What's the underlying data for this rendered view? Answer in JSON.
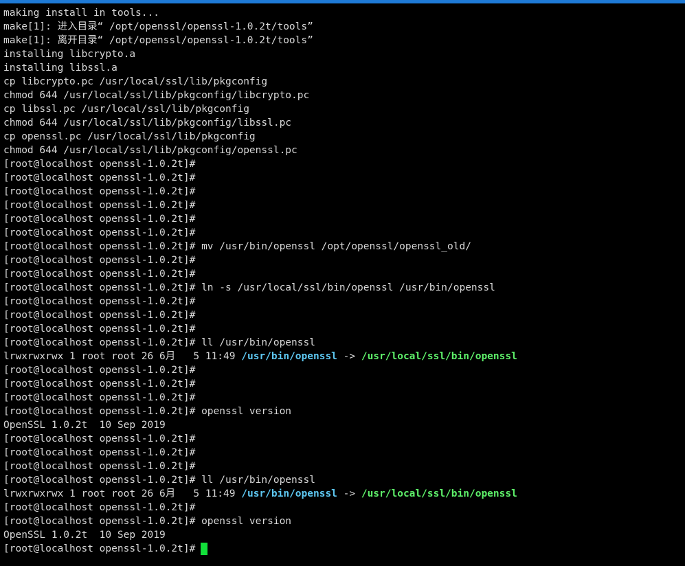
{
  "colors": {
    "background": "#000000",
    "text": "#d8d8d8",
    "symlink": "#5ec8f2",
    "symlink_target": "#5ef06a",
    "cursor": "#12e03a",
    "window_border": "#1e7ad6"
  },
  "terminal": {
    "lines": [
      [
        {
          "t": "making install in tools..."
        }
      ],
      [
        {
          "t": "make[1]: 进入目录“ /opt/openssl/openssl-1.0.2t/tools”"
        }
      ],
      [
        {
          "t": "make[1]: 离开目录“ /opt/openssl/openssl-1.0.2t/tools”"
        }
      ],
      [
        {
          "t": "installing libcrypto.a"
        }
      ],
      [
        {
          "t": "installing libssl.a"
        }
      ],
      [
        {
          "t": "cp libcrypto.pc /usr/local/ssl/lib/pkgconfig"
        }
      ],
      [
        {
          "t": "chmod 644 /usr/local/ssl/lib/pkgconfig/libcrypto.pc"
        }
      ],
      [
        {
          "t": "cp libssl.pc /usr/local/ssl/lib/pkgconfig"
        }
      ],
      [
        {
          "t": "chmod 644 /usr/local/ssl/lib/pkgconfig/libssl.pc"
        }
      ],
      [
        {
          "t": "cp openssl.pc /usr/local/ssl/lib/pkgconfig"
        }
      ],
      [
        {
          "t": "chmod 644 /usr/local/ssl/lib/pkgconfig/openssl.pc"
        }
      ],
      [
        {
          "t": "[root@localhost openssl-1.0.2t]#"
        }
      ],
      [
        {
          "t": "[root@localhost openssl-1.0.2t]#"
        }
      ],
      [
        {
          "t": "[root@localhost openssl-1.0.2t]#"
        }
      ],
      [
        {
          "t": "[root@localhost openssl-1.0.2t]#"
        }
      ],
      [
        {
          "t": "[root@localhost openssl-1.0.2t]#"
        }
      ],
      [
        {
          "t": "[root@localhost openssl-1.0.2t]#"
        }
      ],
      [
        {
          "t": "[root@localhost openssl-1.0.2t]# mv /usr/bin/openssl /opt/openssl/openssl_old/"
        }
      ],
      [
        {
          "t": "[root@localhost openssl-1.0.2t]#"
        }
      ],
      [
        {
          "t": "[root@localhost openssl-1.0.2t]#"
        }
      ],
      [
        {
          "t": "[root@localhost openssl-1.0.2t]# ln -s /usr/local/ssl/bin/openssl /usr/bin/openssl"
        }
      ],
      [
        {
          "t": "[root@localhost openssl-1.0.2t]#"
        }
      ],
      [
        {
          "t": "[root@localhost openssl-1.0.2t]#"
        }
      ],
      [
        {
          "t": "[root@localhost openssl-1.0.2t]#"
        }
      ],
      [
        {
          "t": "[root@localhost openssl-1.0.2t]# ll /usr/bin/openssl"
        }
      ],
      [
        {
          "t": "lrwxrwxrwx 1 root root 26 6月   5 11:49 "
        },
        {
          "t": "/usr/bin/openssl",
          "c": "link"
        },
        {
          "t": " -> "
        },
        {
          "t": "/usr/local/ssl/bin/openssl",
          "c": "target"
        }
      ],
      [
        {
          "t": "[root@localhost openssl-1.0.2t]#"
        }
      ],
      [
        {
          "t": "[root@localhost openssl-1.0.2t]#"
        }
      ],
      [
        {
          "t": "[root@localhost openssl-1.0.2t]#"
        }
      ],
      [
        {
          "t": "[root@localhost openssl-1.0.2t]# openssl version"
        }
      ],
      [
        {
          "t": "OpenSSL 1.0.2t  10 Sep 2019"
        }
      ],
      [
        {
          "t": "[root@localhost openssl-1.0.2t]#"
        }
      ],
      [
        {
          "t": "[root@localhost openssl-1.0.2t]#"
        }
      ],
      [
        {
          "t": "[root@localhost openssl-1.0.2t]#"
        }
      ],
      [
        {
          "t": "[root@localhost openssl-1.0.2t]# ll /usr/bin/openssl"
        }
      ],
      [
        {
          "t": "lrwxrwxrwx 1 root root 26 6月   5 11:49 "
        },
        {
          "t": "/usr/bin/openssl",
          "c": "link"
        },
        {
          "t": " -> "
        },
        {
          "t": "/usr/local/ssl/bin/openssl",
          "c": "target"
        }
      ],
      [
        {
          "t": "[root@localhost openssl-1.0.2t]#"
        }
      ],
      [
        {
          "t": "[root@localhost openssl-1.0.2t]# openssl version"
        }
      ],
      [
        {
          "t": "OpenSSL 1.0.2t  10 Sep 2019"
        }
      ]
    ],
    "prompt": {
      "text": "[root@localhost openssl-1.0.2t]#",
      "input_value": ""
    }
  }
}
